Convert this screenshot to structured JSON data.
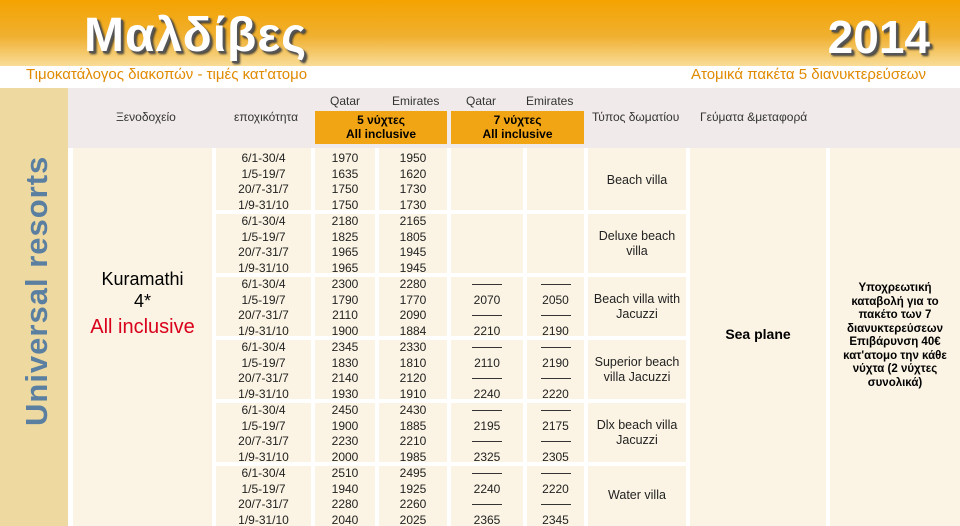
{
  "title": "Μαλδίβες",
  "year": "2014",
  "subtitle": "Τιμοκατάλογος διακοπών  - τιμές κατ'ατομο",
  "packets": "Ατομικά πακέτα 5 διανυκτερεύσεων",
  "side_label": "Universal resorts",
  "header": {
    "hotel": "Ξενοδοχείο",
    "season": "εποχικότητα",
    "carriers": [
      "Qatar",
      "Emirates",
      "Qatar",
      "Emirates"
    ],
    "nights5": [
      "5 νύχτες",
      "All inclusive"
    ],
    "nights7": [
      "7 νύχτες",
      "All inclusive"
    ],
    "room_type": "Τύπος δωματίου",
    "meals": "Γεύματα &μεταφορά"
  },
  "hotel": {
    "name": "Kuramathi",
    "stars": "4*",
    "board": "All inclusive"
  },
  "seasons": [
    "6/1-30/4",
    "1/5-19/7",
    "20/7-31/7",
    "1/9-31/10"
  ],
  "rows": [
    {
      "room": "Beach villa",
      "c1": [
        "1970",
        "1635",
        "1750",
        "1750"
      ],
      "c2": [
        "1950",
        "1620",
        "1730",
        "1730"
      ],
      "c3": [],
      "c4": []
    },
    {
      "room": "Deluxe beach villa",
      "c1": [
        "2180",
        "1825",
        "1965",
        "1965"
      ],
      "c2": [
        "2165",
        "1805",
        "1945",
        "1945"
      ],
      "c3": [],
      "c4": []
    },
    {
      "room": "Beach villa with Jacuzzi",
      "c1": [
        "2300",
        "1790",
        "2110",
        "1900"
      ],
      "c2": [
        "2280",
        "1770",
        "2090",
        "1884"
      ],
      "c3": [
        "2070",
        "2210"
      ],
      "c4": [
        "2050",
        "2190"
      ]
    },
    {
      "room": "Superior beach villa Jacuzzi",
      "c1": [
        "2345",
        "1830",
        "2140",
        "1930"
      ],
      "c2": [
        "2330",
        "1810",
        "2120",
        "1910"
      ],
      "c3": [
        "2110",
        "2240"
      ],
      "c4": [
        "2190",
        "2220"
      ]
    },
    {
      "room": "Dlx beach villa Jacuzzi",
      "c1": [
        "2450",
        "1900",
        "2230",
        "2000"
      ],
      "c2": [
        "2430",
        "1885",
        "2210",
        "1985"
      ],
      "c3": [
        "2195",
        "2325"
      ],
      "c4": [
        "2175",
        "2305"
      ]
    },
    {
      "room": "Water villa",
      "c1": [
        "2510",
        "1940",
        "2280",
        "2040"
      ],
      "c2": [
        "2495",
        "1925",
        "2260",
        "2025"
      ],
      "c3": [
        "2240",
        "2365"
      ],
      "c4": [
        "2220",
        "2345"
      ]
    }
  ],
  "transfer": "Sea plane",
  "note": "Υποχρεωτική καταβολή για το πακέτο των 7 διανυκτερεύσεων Επιβάρυνση 40€ κατ'ατομο την κάθε νύχτα (2 νύχτες συνολικά)"
}
